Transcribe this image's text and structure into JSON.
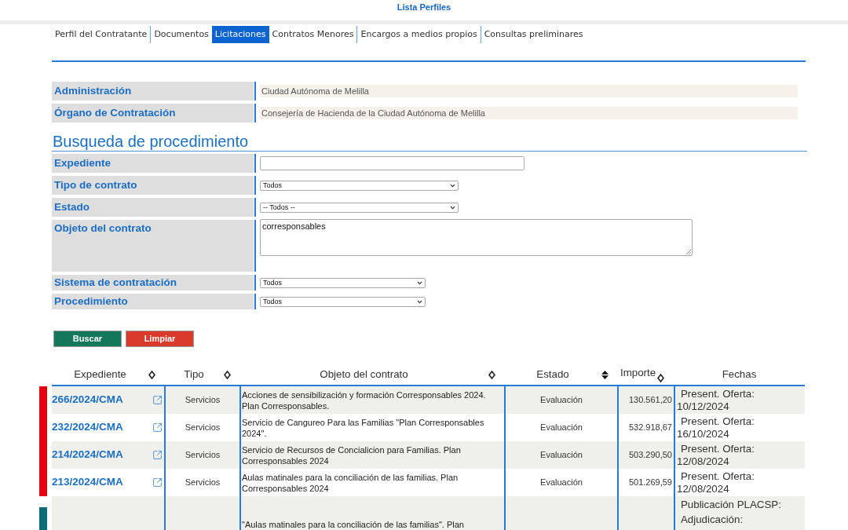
{
  "header": {
    "title": "Lista Perfiles"
  },
  "tabs": [
    {
      "label": "Perfil del Contratante",
      "selected": false
    },
    {
      "label": "Documentos",
      "selected": false
    },
    {
      "label": "Licitaciones",
      "selected": true
    },
    {
      "label": "Contratos Menores",
      "selected": false
    },
    {
      "label": "Encargos a medios propios",
      "selected": false
    },
    {
      "label": "Consultas preliminares",
      "selected": false
    }
  ],
  "info": [
    {
      "label": "Administración",
      "value": "Ciudad Autónoma de Melilla"
    },
    {
      "label": "Órgano de Contratación",
      "value": "Consejería de Hacienda de la Ciudad Autónoma de Melilla"
    }
  ],
  "search": {
    "title": "Busqueda de procedimiento",
    "fields": [
      {
        "label": "Expediente",
        "kind": "text"
      },
      {
        "label": "Tipo de contrato",
        "kind": "select",
        "value": "Todos"
      },
      {
        "label": "Estado",
        "kind": "select",
        "value": "-- Todos --"
      },
      {
        "label": "Objeto del contrato",
        "kind": "textarea",
        "value": "corresponsables"
      },
      {
        "label": "Sistema de contratación",
        "kind": "select",
        "value": "Todos"
      },
      {
        "label": "Procedimiento",
        "kind": "select",
        "value": "Todos"
      }
    ]
  },
  "actions": [
    {
      "label": "Buscar",
      "kind": "primary"
    },
    {
      "label": "Limpiar",
      "kind": "danger"
    }
  ],
  "table": {
    "columns": [
      {
        "label": "Expediente",
        "sortable": true,
        "sorted": false
      },
      {
        "label": "Tipo",
        "sortable": true,
        "sorted": false
      },
      {
        "label": "Objeto del contrato",
        "sortable": true,
        "sorted": false
      },
      {
        "label": "Estado",
        "sortable": true,
        "sorted": true
      },
      {
        "label": "Importe",
        "sortable": true,
        "sorted": false
      },
      {
        "label": "Fechas",
        "sortable": false
      }
    ],
    "rows": [
      {
        "color": "#e3000f",
        "expediente": "266/2024/CMA",
        "tipo": "Servicios",
        "objeto": "Acciones de sensibilización y formación Corresponsables 2024. Plan Corresponsables.",
        "estado": "Evaluación",
        "importe": "130.561,20",
        "fechas": [
          {
            "label": "Present. Oferta:",
            "value": "10/12/2024"
          }
        ]
      },
      {
        "color": "#e3000f",
        "expediente": "232/2024/CMA",
        "tipo": "Servicios",
        "objeto": "Servicio de Cangureo Para las Familias \"Plan Corresponsables 2024\".",
        "estado": "Evaluación",
        "importe": "532.918,67",
        "fechas": [
          {
            "label": "Present. Oferta:",
            "value": "16/10/2024"
          }
        ]
      },
      {
        "color": "#e3000f",
        "expediente": "214/2024/CMA",
        "tipo": "Servicios",
        "objeto": "Servicio de Recursos de Concialicion para Familias. Plan Corresponsables 2024",
        "estado": "Evaluación",
        "importe": "503.290,50",
        "fechas": [
          {
            "label": "Present. Oferta:",
            "value": "12/08/2024"
          }
        ]
      },
      {
        "color": "#e3000f",
        "expediente": "213/2024/CMA",
        "tipo": "Servicios",
        "objeto": "Aulas matinales para la conciliación de las familias. Plan Corresponsables 2024",
        "estado": "Evaluación",
        "importe": "501.269,59",
        "fechas": [
          {
            "label": "Present. Oferta:",
            "value": "12/08/2024"
          }
        ]
      },
      {
        "color": "#0d6b7a",
        "objeto": "\"Aulas matinales para la conciliación de las familias\". Plan",
        "fechas": [
          {
            "label": "Publicación PLACSP:"
          },
          {
            "label": "Adjudicación:"
          }
        ]
      }
    ]
  }
}
